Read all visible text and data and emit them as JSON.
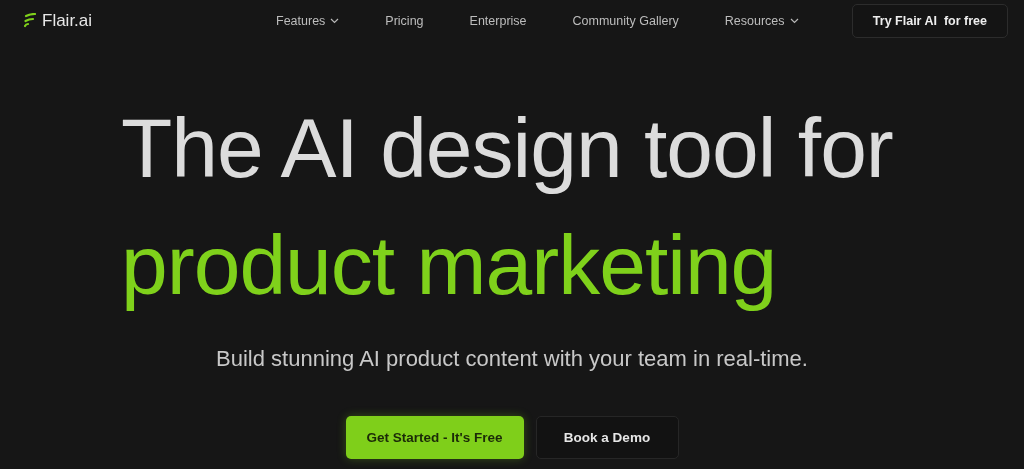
{
  "brand": {
    "name": "Flair.ai"
  },
  "nav": [
    {
      "label": "Features",
      "has_menu": true
    },
    {
      "label": "Pricing",
      "has_menu": false
    },
    {
      "label": "Enterprise",
      "has_menu": false
    },
    {
      "label": "Community Gallery",
      "has_menu": false
    },
    {
      "label": "Resources",
      "has_menu": true
    }
  ],
  "nav_cta": "Try Flair AI  for free",
  "hero": {
    "headline": [
      "The AI design tool for",
      "product marketing"
    ],
    "subtitle": "Build stunning AI product content with your team in real-time.",
    "buttons": [
      {
        "label": "Get Started - It's Free",
        "kind": "primary"
      },
      {
        "label": "Book a Demo",
        "kind": "secondary"
      }
    ]
  }
}
